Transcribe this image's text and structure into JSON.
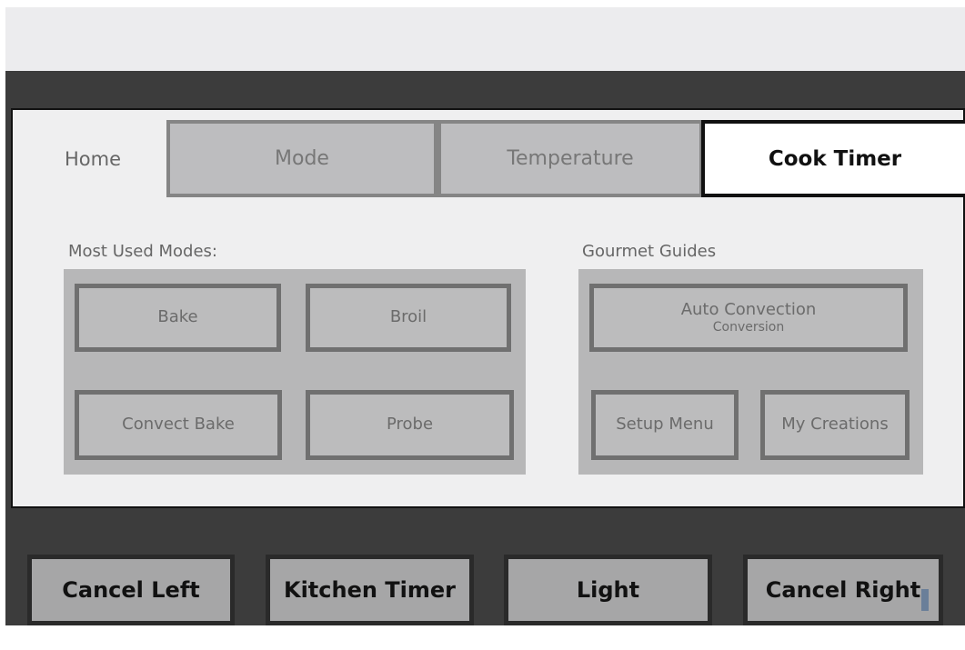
{
  "tabs": {
    "home": "Home",
    "mode": "Mode",
    "temperature": "Temperature",
    "cook_timer": "Cook Timer",
    "active": "cook_timer"
  },
  "most_used": {
    "title": "Most Used Modes:",
    "buttons": [
      "Bake",
      "Broil",
      "Convect Bake",
      "Probe"
    ]
  },
  "gourmet": {
    "title": "Gourmet Guides",
    "auto_convection": "Auto Convection",
    "auto_convection_sub": "Conversion",
    "setup_menu": "Setup Menu",
    "my_creations": "My Creations"
  },
  "bottom": {
    "cancel_left": "Cancel Left",
    "kitchen_timer": "Kitchen Timer",
    "light": "Light",
    "cancel_right": "Cancel Right"
  }
}
